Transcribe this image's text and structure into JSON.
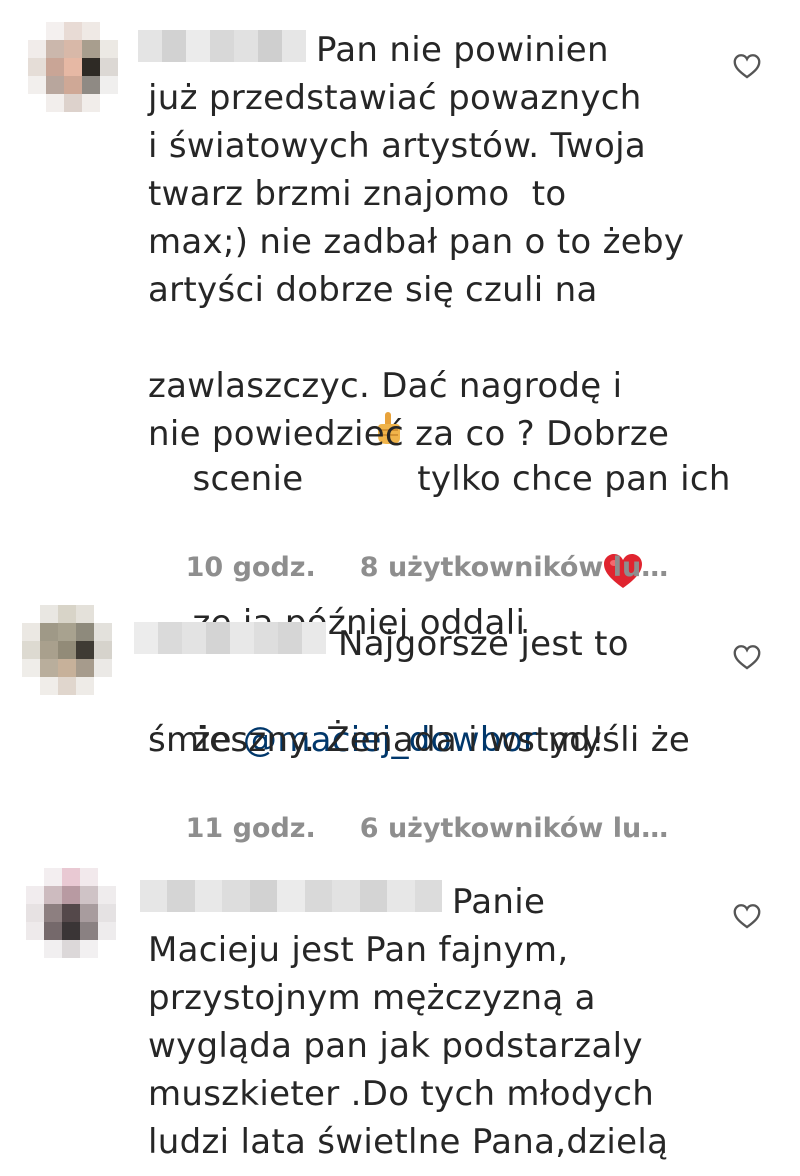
{
  "comments": [
    {
      "lines": [
        "Pan nie powinien",
        "już przedstawiać powaznych",
        "i światowych artystów. Twoja",
        "twarz brzmi znajomo  to",
        "max;) nie zadbał pan o to żeby",
        "artyści dobrze się czuli na"
      ],
      "line7_a": "scenie",
      "line7_b": " tylko chce pan ich",
      "line8": "zawlaszczyc. Dać nagrodę i",
      "line9": "nie powiedzieć za co ? Dobrze",
      "line10": "ze ja później oddali ",
      "time": "10 godz.",
      "likes": "8 użytkowników lu…"
    },
    {
      "line1": "Najgorsze jest to",
      "line2_a": "że ",
      "mention": "@maciej_dowbor",
      "line2_b": " myśli że",
      "line3": "śmieszny. Żenada i wstyd!",
      "time": "11 godz.",
      "likes": "6 użytkowników lu…"
    },
    {
      "lines": [
        "Panie",
        "Macieju jest Pan fajnym,",
        "przystojnym mężczyzną a",
        "wygląda pan jak podstarzaly",
        "muszkieter .Do tych młodych",
        "ludzi lata świetlne Pana,dzielą"
      ]
    }
  ],
  "icons": {
    "like": "heart-outline-icon",
    "pointing": "pointing-up-emoji",
    "red_heart": "red-heart-emoji"
  },
  "colors": {
    "text": "#262626",
    "meta": "#8e8e8e",
    "mention": "#00376b",
    "heart_emoji": "#e0242f"
  }
}
